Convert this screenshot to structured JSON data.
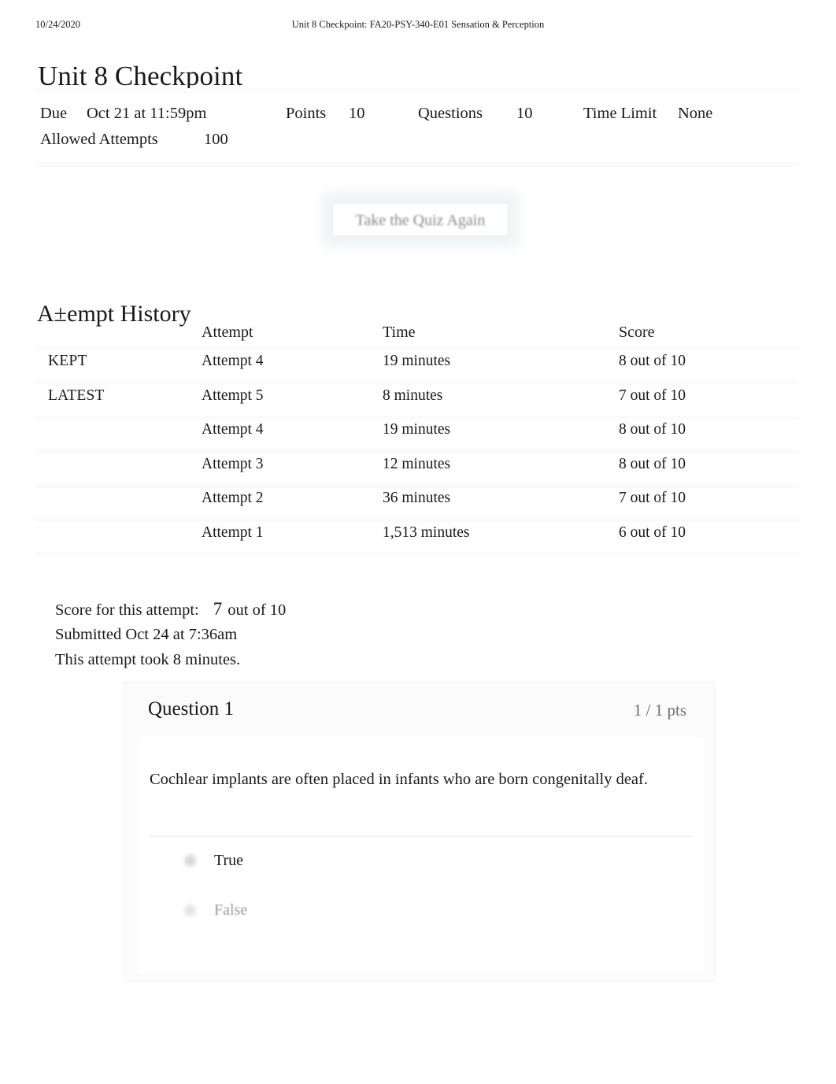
{
  "print_header": {
    "date": "10/24/2020",
    "document_title": "Unit 8 Checkpoint: FA20-PSY-340-E01 Sensation & Perception"
  },
  "page_title": "Unit 8 Checkpoint",
  "quiz_info": {
    "due_label": "Due",
    "due_value": "Oct 21 at 11:59pm",
    "points_label": "Points",
    "points_value": "10",
    "questions_label": "Questions",
    "questions_value": "10",
    "time_limit_label": "Time Limit",
    "time_limit_value": "None",
    "allowed_attempts_label": "Allowed Attempts",
    "allowed_attempts_value": "100"
  },
  "retake_button_label": "Take the Quiz Again",
  "attempt_history": {
    "heading": "A±empt History",
    "columns": {
      "status": "",
      "attempt": "Attempt",
      "time": "Time",
      "score": "Score"
    },
    "rows": [
      {
        "status": "KEPT",
        "attempt": "Attempt 4",
        "time": "19 minutes",
        "score": "8 out of 10"
      },
      {
        "status": "LATEST",
        "attempt": "Attempt 5",
        "time": "8 minutes",
        "score": "7 out of 10"
      },
      {
        "status": "",
        "attempt": "Attempt 4",
        "time": "19 minutes",
        "score": "8 out of 10"
      },
      {
        "status": "",
        "attempt": "Attempt 3",
        "time": "12 minutes",
        "score": "8 out of 10"
      },
      {
        "status": "",
        "attempt": "Attempt 2",
        "time": "36 minutes",
        "score": "7 out of 10"
      },
      {
        "status": "",
        "attempt": "Attempt 1",
        "time": "1,513 minutes",
        "score": "6 out of 10"
      }
    ]
  },
  "score_summary": {
    "score_label": "Score for this attempt:",
    "score_value": "7",
    "score_suffix": "out of 10",
    "submitted": "Submitted Oct 24 at 7:36am",
    "duration": "This attempt took 8 minutes."
  },
  "question": {
    "number": "Question 1",
    "points": "1 / 1 pts",
    "text": "Cochlear implants are often placed in infants who are born congenitally deaf.",
    "answers": [
      {
        "label": "True",
        "selected": true
      },
      {
        "label": "False",
        "selected": false
      }
    ]
  },
  "colors": {
    "link": "#2196e0",
    "text": "#1a1a1a",
    "muted": "#9b9b9b",
    "card_bg": "#fbfbfb",
    "rule": "#fafbfb"
  }
}
